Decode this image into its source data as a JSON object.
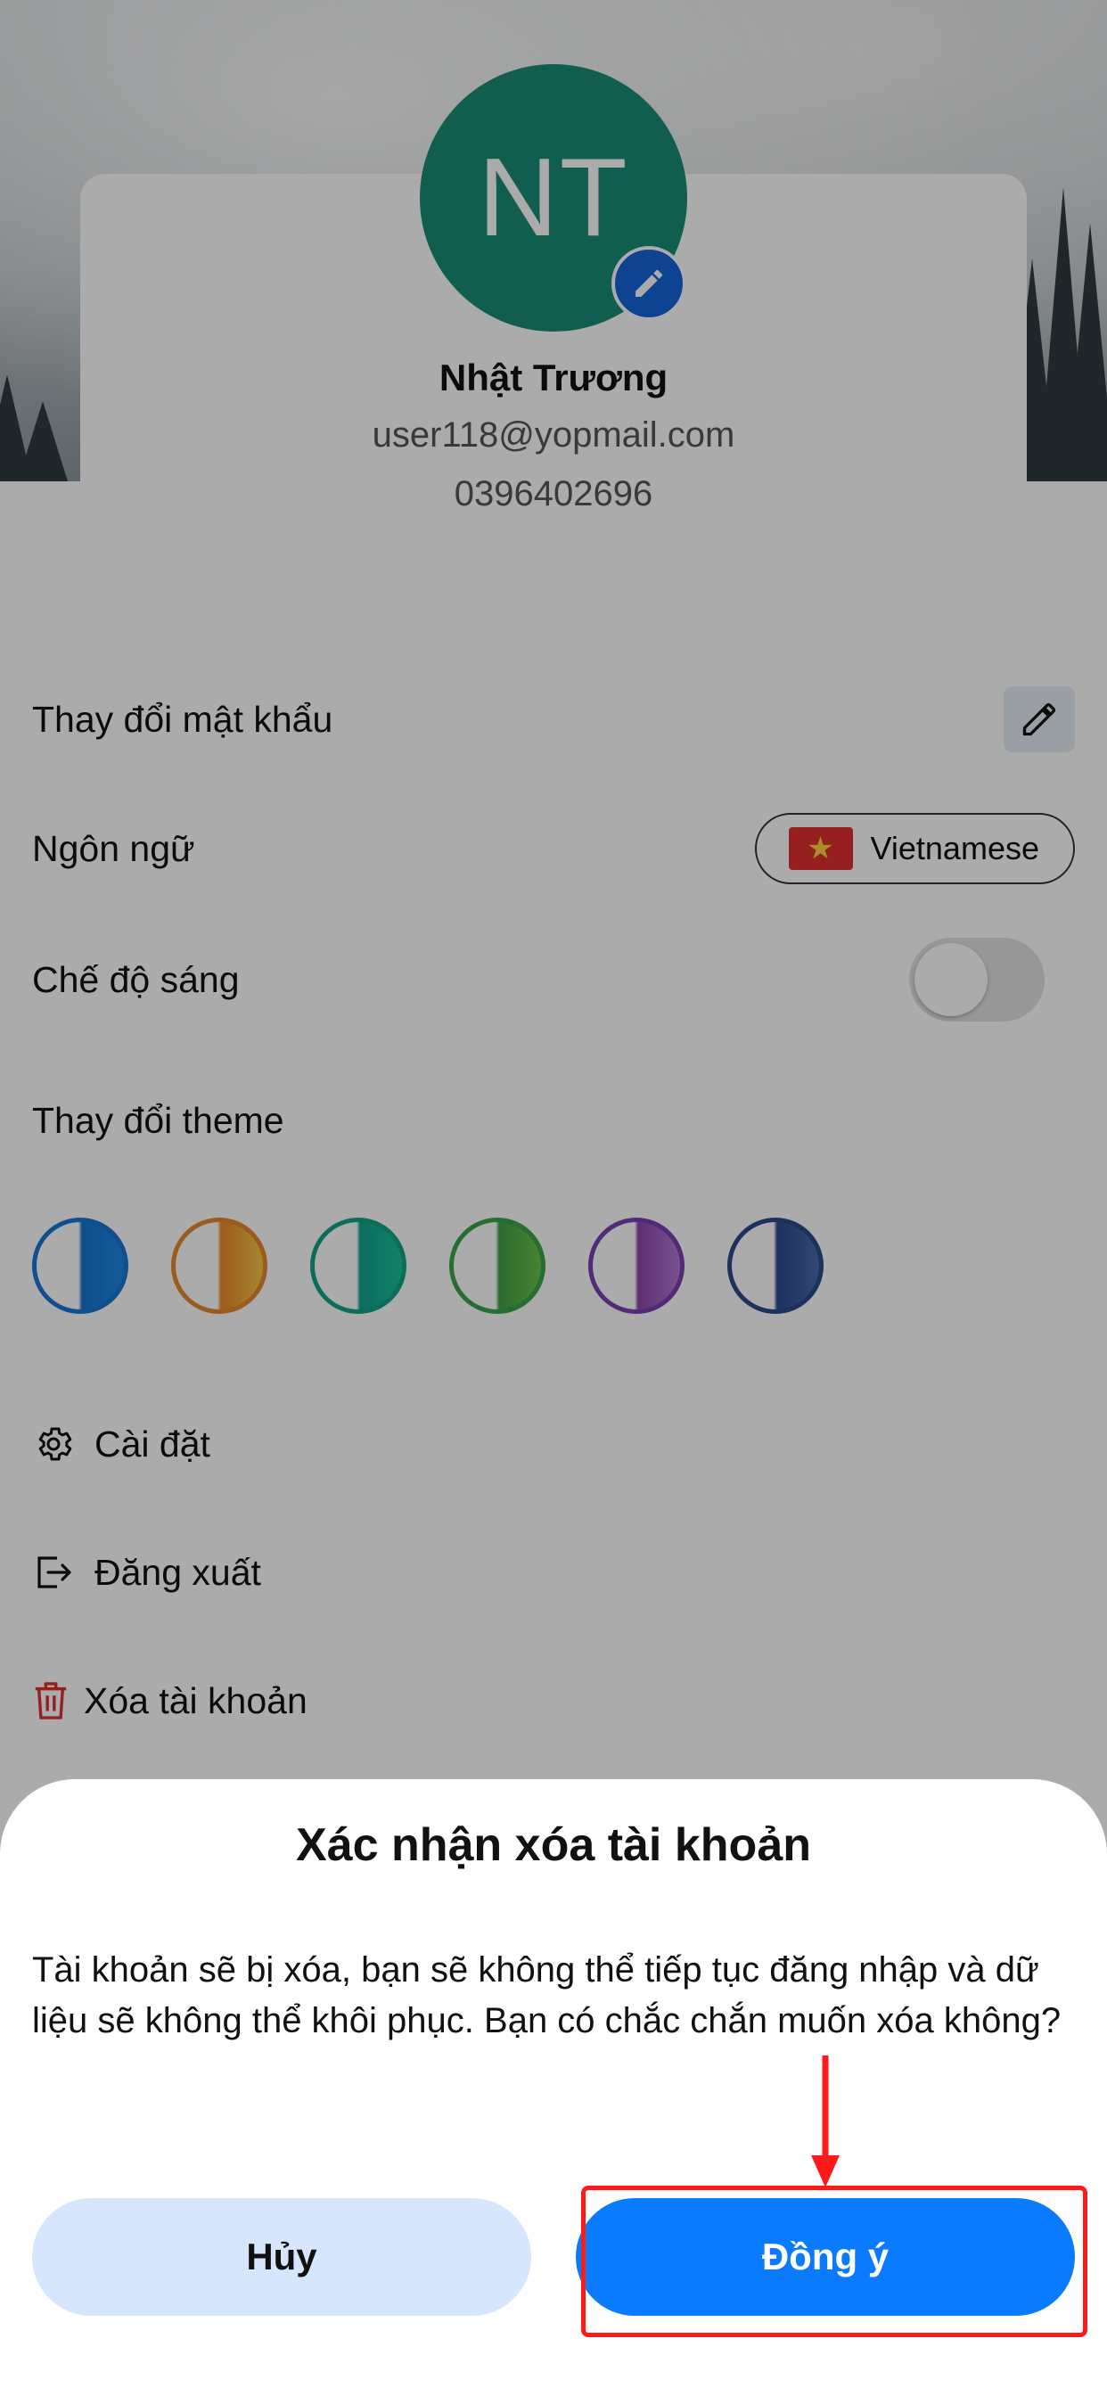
{
  "profile": {
    "initials": "NT",
    "name": "Nhật Trương",
    "email": "user118@yopmail.com",
    "phone": "0396402696",
    "avatar_color": "#1a8c78"
  },
  "settings": {
    "change_password": "Thay đổi mật khẩu",
    "language_label": "Ngôn ngữ",
    "language_value": "Vietnamese",
    "light_mode_label": "Chế độ sáng",
    "light_mode_on": false,
    "theme_label": "Thay đổi theme",
    "theme_colors": [
      "#1976d2",
      "#e68a2e",
      "#14a38b",
      "#3aa34a",
      "#7b3fb3",
      "#2b4a8a"
    ]
  },
  "menu": {
    "settings": "Cài đặt",
    "logout": "Đăng xuất",
    "delete_account": "Xóa tài khoản"
  },
  "dialog": {
    "title": "Xác nhận xóa tài khoản",
    "message": "Tài khoản sẽ bị xóa, bạn sẽ không thể tiếp tục đăng nhập và dữ liệu sẽ không thể khôi phục. Bạn có chắc chắn muốn xóa không?",
    "cancel_label": "Hủy",
    "confirm_label": "Đồng ý"
  },
  "colors": {
    "primary": "#0a7bff",
    "cancel_bg": "#d6e7fd",
    "danger": "#e03131",
    "annotation": "#ff1a1a"
  }
}
